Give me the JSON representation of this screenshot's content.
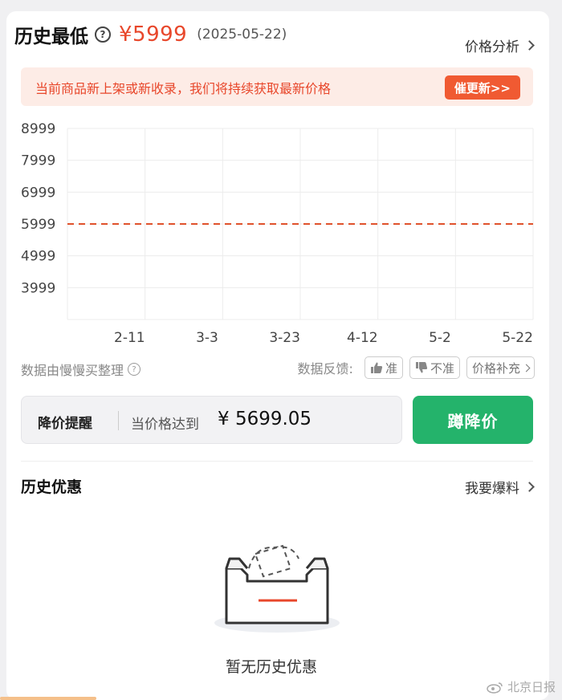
{
  "header": {
    "title": "历史最低",
    "help_glyph": "?",
    "price": "¥5999",
    "date": "(2025-05-22)",
    "analysis_link": "价格分析"
  },
  "notice": {
    "text": "当前商品新上架或新收录，我们将持续获取最新价格",
    "button": "催更新>>"
  },
  "chart_data": {
    "type": "line",
    "title": "",
    "xlabel": "",
    "ylabel": "",
    "y_ticks": [
      "8999",
      "7999",
      "6999",
      "5999",
      "4999",
      "3999"
    ],
    "ylim": [
      2999,
      8999
    ],
    "x_ticks": [
      "2-11",
      "3-3",
      "3-23",
      "4-12",
      "5-2",
      "5-22"
    ],
    "series": [
      {
        "x": [
          "2-11",
          "5-22"
        ],
        "values": [
          5999,
          5999
        ],
        "style": "dashed",
        "color": "#e0522c"
      }
    ],
    "grid": true
  },
  "source": {
    "text": "数据由慢慢买整理",
    "help_glyph": "?",
    "feedback_label": "数据反馈:",
    "accurate": "准",
    "inaccurate": "不准",
    "supplement": "价格补充"
  },
  "alert": {
    "label": "降价提醒",
    "condition": "当价格达到",
    "price": "¥ 5699.05",
    "button": "蹲降价"
  },
  "history": {
    "title": "历史优惠",
    "report_link": "我要爆料",
    "empty_text": "暂无历史优惠"
  },
  "watermark": "北京日报",
  "colors": {
    "accent": "#e8472b",
    "green": "#24b36b",
    "notice_bg": "#fdece6"
  }
}
